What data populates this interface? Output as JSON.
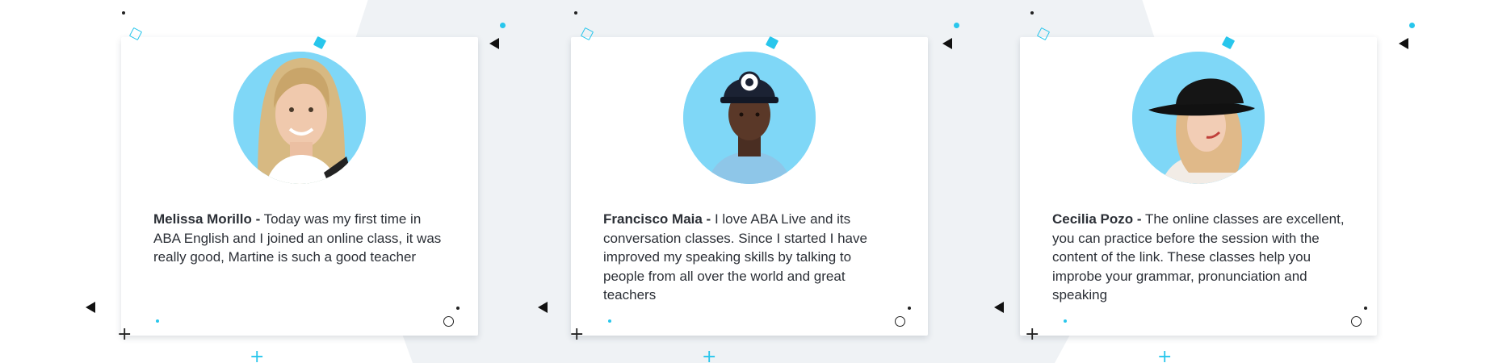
{
  "colors": {
    "accent": "#28c6ec",
    "avatar_bg": "#7fd7f7",
    "background_shape": "#eff2f5",
    "text": "#2b2f36"
  },
  "testimonials": [
    {
      "name": "Melissa Morillo -",
      "text": " Today was my first time in ABA English and I joined an online class, it was really good, Martine is such a good teacher",
      "avatar": "woman-blonde-smiling-photo"
    },
    {
      "name": "Francisco Maia -",
      "text": " I love ABA Live and its conversation classes. Since I started I have improved my speaking skills by talking to people from all over the world and great teachers",
      "avatar": "man-cap-blue-sweater-photo"
    },
    {
      "name": "Cecilia Pozo -",
      "text": " The online classes are excellent, you can practice before the session with the content of the link. These classes help you improbe your grammar, pronunciation and speaking",
      "avatar": "woman-black-hat-photo"
    }
  ]
}
